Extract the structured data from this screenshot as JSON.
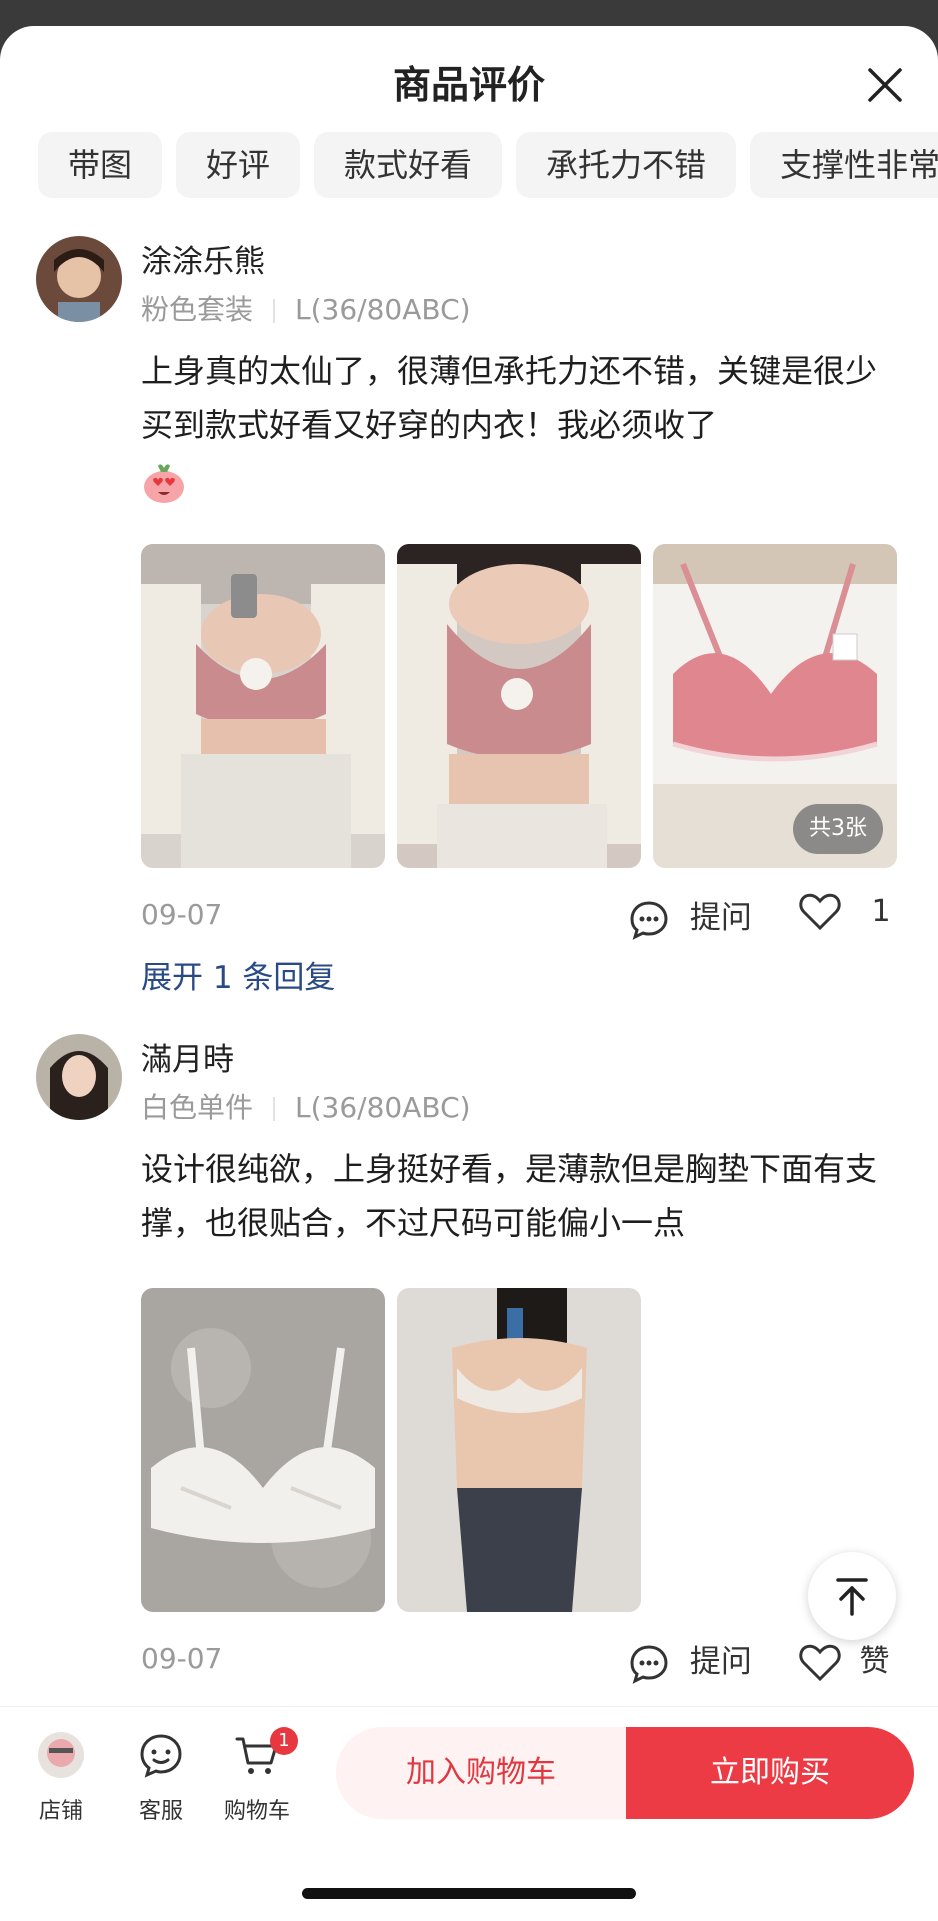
{
  "header": {
    "title": "商品评价",
    "close_icon": "close-icon"
  },
  "filter_chips": [
    "带图",
    "好评",
    "款式好看",
    "承托力不错",
    "支撑性非常好"
  ],
  "reviews": [
    {
      "username": "涂涂乐熊",
      "variant": "粉色套装",
      "size": "L(36/80ABC)",
      "text": "上身真的太仙了，很薄但承托力还不错，关键是很少买到款式好看又好穿的内衣！我必须收了",
      "emoji": "heart-eyes-emoji",
      "photo_count_label": "共3张",
      "date": "09-07",
      "ask_label": "提问",
      "like_count": "1",
      "expand_label": "展开 1 条回复"
    },
    {
      "username": "滿月時",
      "variant": "白色单件",
      "size": "L(36/80ABC)",
      "text": "设计很纯欲，上身挺好看，是薄款但是胸垫下面有支撑，也很贴合，不过尺码可能偏小一点",
      "date": "09-07",
      "ask_label": "提问",
      "like_label": "赞"
    }
  ],
  "bottom_nav": {
    "store_label": "店铺",
    "service_label": "客服",
    "cart_label": "购物车",
    "cart_badge": "1",
    "add_to_cart_label": "加入购物车",
    "buy_now_label": "立即购买"
  },
  "colors": {
    "accent_red": "#ec3b45",
    "link_blue": "#2a4a86",
    "muted_gray": "#9a9a9a"
  }
}
